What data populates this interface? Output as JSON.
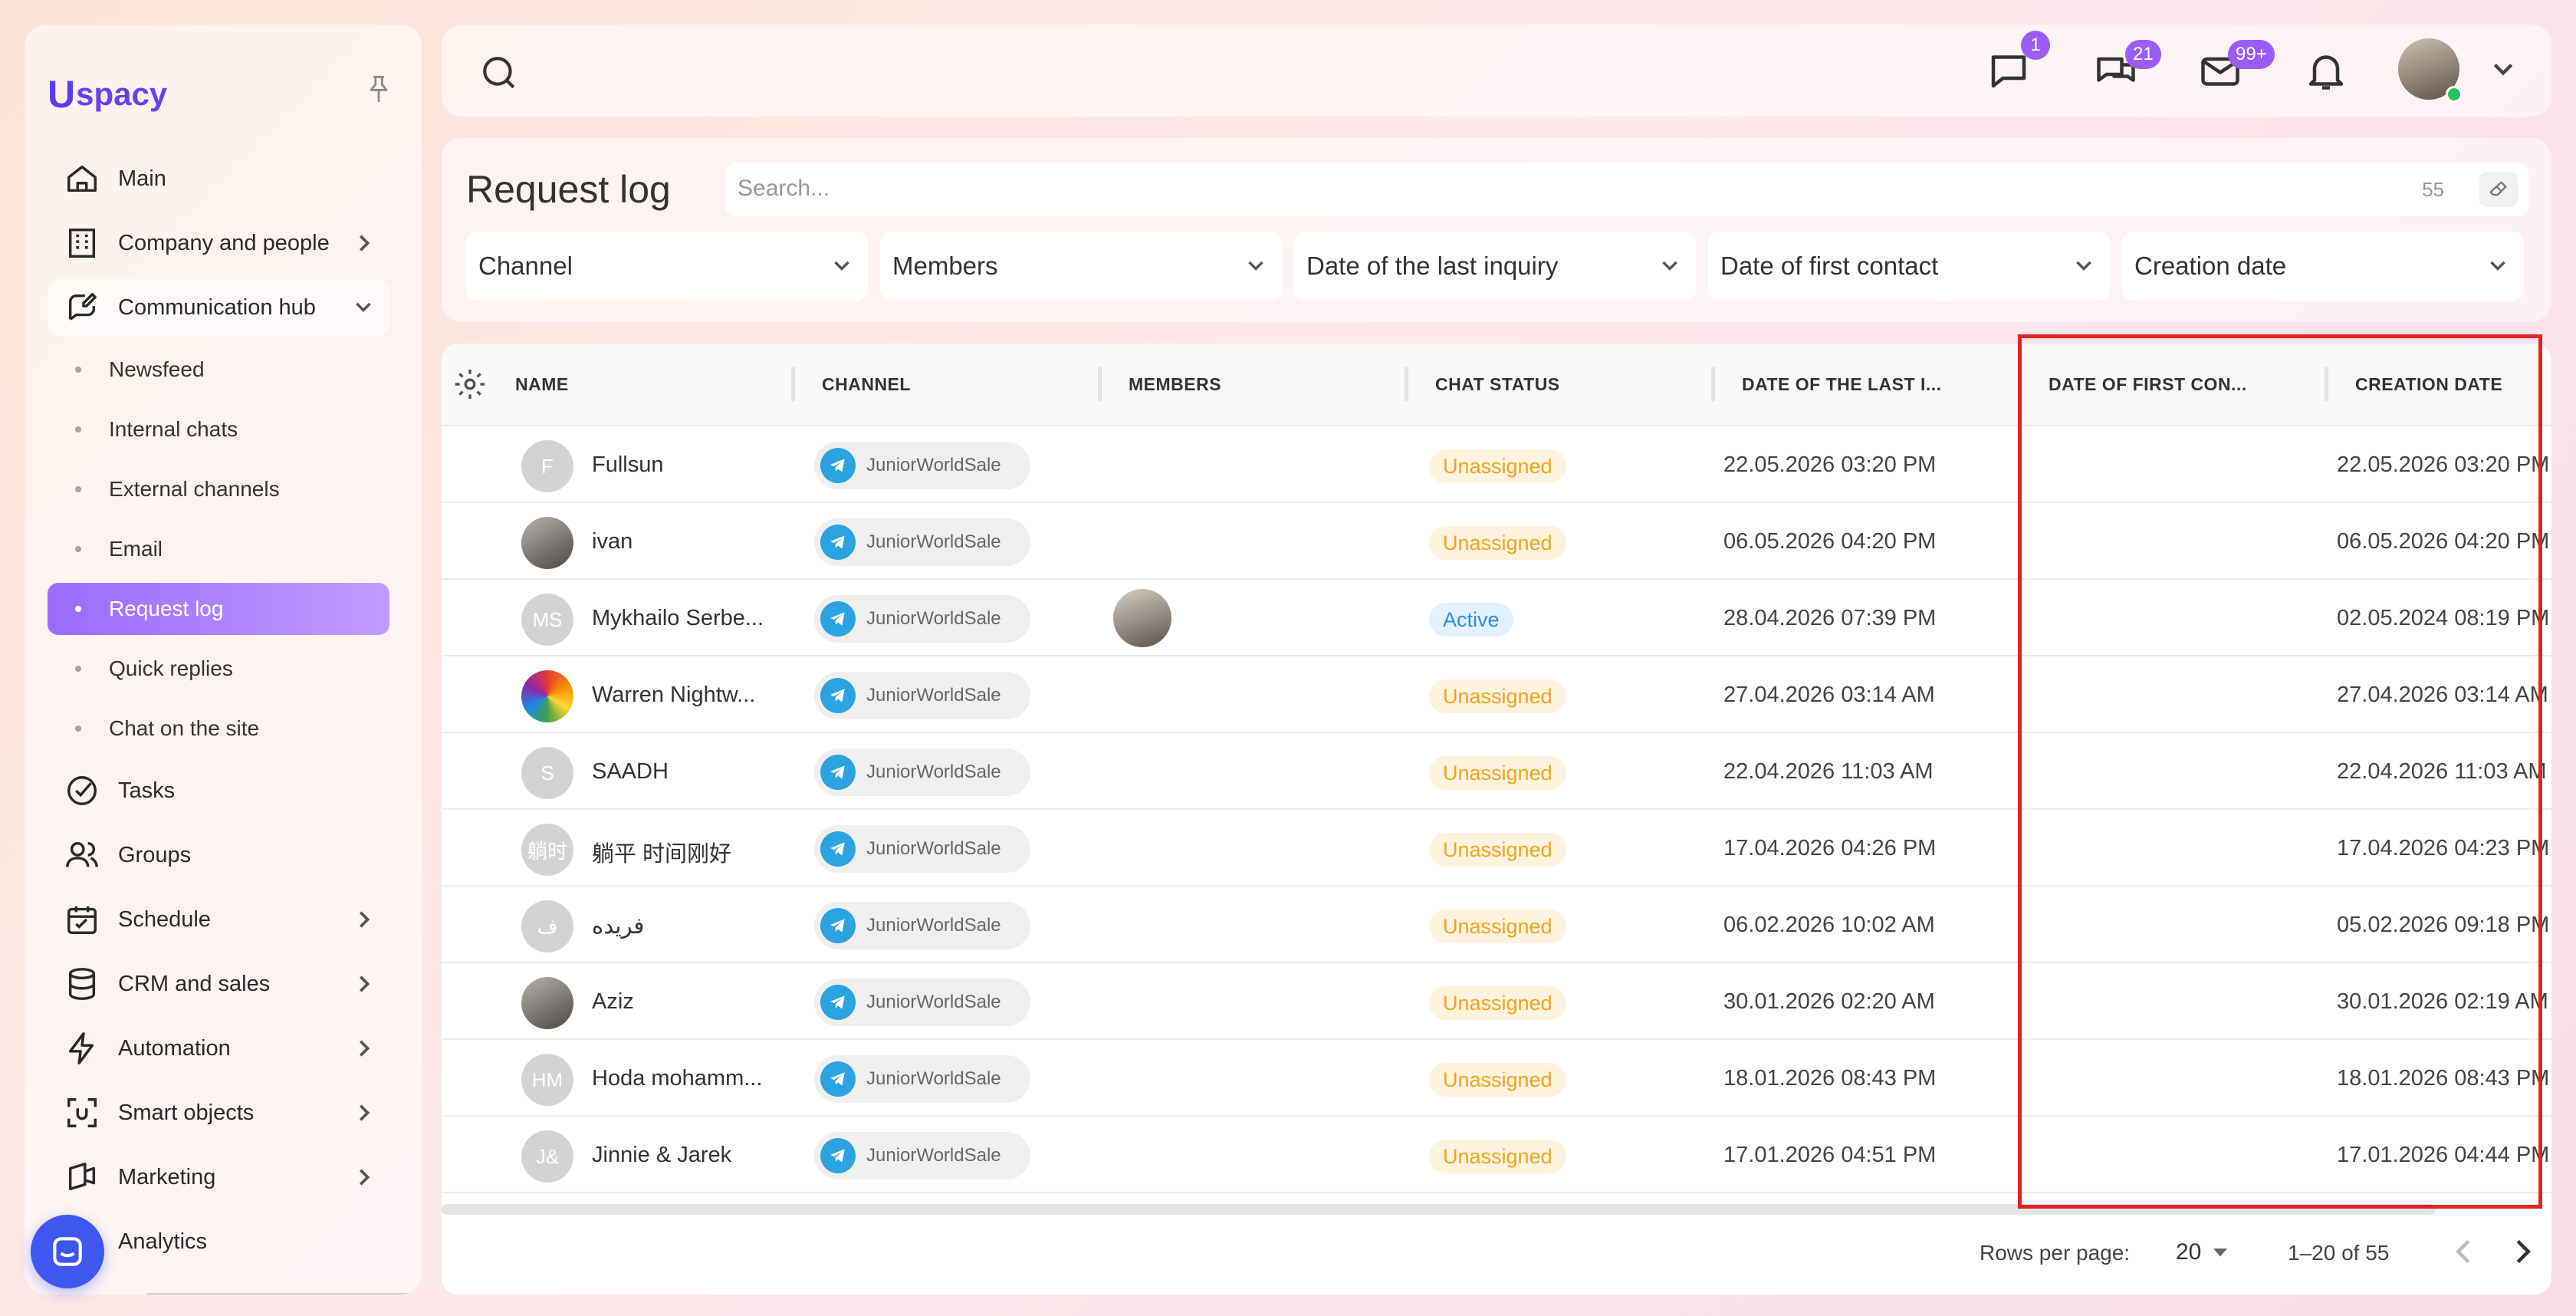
{
  "app": {
    "logo_mark": "U",
    "logo_text": "spacy"
  },
  "sidebar": {
    "items": [
      {
        "label": "Main",
        "icon": "home-icon"
      },
      {
        "label": "Company and people",
        "icon": "building-icon"
      },
      {
        "label": "Communication hub",
        "icon": "chat-edit-icon"
      }
    ],
    "sub_items": [
      "Newsfeed",
      "Internal chats",
      "External channels",
      "Email",
      "Request log",
      "Quick replies",
      "Chat on the site"
    ],
    "active_sub": "Request log",
    "items_after": [
      {
        "label": "Tasks",
        "icon": "check-circle-icon"
      },
      {
        "label": "Groups",
        "icon": "users-icon"
      },
      {
        "label": "Schedule",
        "icon": "calendar-icon"
      },
      {
        "label": "CRM and sales",
        "icon": "database-icon"
      },
      {
        "label": "Automation",
        "icon": "lightning-icon"
      },
      {
        "label": "Smart objects",
        "icon": "scan-icon"
      },
      {
        "label": "Marketing",
        "icon": "megaphone-icon"
      },
      {
        "label": "Analytics",
        "icon": "chart-icon"
      }
    ]
  },
  "topbar": {
    "badges": {
      "messages": "1",
      "chats": "21",
      "mail": "99+"
    }
  },
  "filters": {
    "title": "Request log",
    "search_placeholder": "Search...",
    "count": "55",
    "dropdowns": [
      "Channel",
      "Members",
      "Date of the last inquiry",
      "Date of first contact",
      "Creation date"
    ]
  },
  "table": {
    "columns": [
      "NAME",
      "CHANNEL",
      "MEMBERS",
      "CHAT STATUS",
      "DATE OF THE LAST I...",
      "DATE OF FIRST CON...",
      "CREATION DATE"
    ],
    "rows": [
      {
        "initials": "F",
        "avatar": "initials",
        "name": "Fullsun",
        "channel": "JuniorWorldSale",
        "member": false,
        "status": "Unassigned",
        "last": "22.05.2026 03:20 PM",
        "first": "",
        "created": "22.05.2026 03:20 PM"
      },
      {
        "initials": "",
        "avatar": "photo",
        "name": "ivan",
        "channel": "JuniorWorldSale",
        "member": false,
        "status": "Unassigned",
        "last": "06.05.2026 04:20 PM",
        "first": "",
        "created": "06.05.2026 04:20 PM"
      },
      {
        "initials": "MS",
        "avatar": "initials",
        "name": "Mykhailo Serbe...",
        "channel": "JuniorWorldSale",
        "member": true,
        "status": "Active",
        "last": "28.04.2026 07:39 PM",
        "first": "",
        "created": "02.05.2024 08:19 PM"
      },
      {
        "initials": "",
        "avatar": "rainbow",
        "name": "Warren Nightw...",
        "channel": "JuniorWorldSale",
        "member": false,
        "status": "Unassigned",
        "last": "27.04.2026 03:14 AM",
        "first": "",
        "created": "27.04.2026 03:14 AM"
      },
      {
        "initials": "S",
        "avatar": "initials",
        "name": "SAADH",
        "channel": "JuniorWorldSale",
        "member": false,
        "status": "Unassigned",
        "last": "22.04.2026 11:03 AM",
        "first": "",
        "created": "22.04.2026 11:03 AM"
      },
      {
        "initials": "躺时",
        "avatar": "initials",
        "name": "躺平 时间刚好",
        "channel": "JuniorWorldSale",
        "member": false,
        "status": "Unassigned",
        "last": "17.04.2026 04:26 PM",
        "first": "",
        "created": "17.04.2026 04:23 PM"
      },
      {
        "initials": "ف",
        "avatar": "initials",
        "name": "فريده",
        "channel": "JuniorWorldSale",
        "member": false,
        "status": "Unassigned",
        "last": "06.02.2026 10:02 AM",
        "first": "",
        "created": "05.02.2026 09:18 PM"
      },
      {
        "initials": "",
        "avatar": "photo",
        "name": "Aziz",
        "channel": "JuniorWorldSale",
        "member": false,
        "status": "Unassigned",
        "last": "30.01.2026 02:20 AM",
        "first": "",
        "created": "30.01.2026 02:19 AM"
      },
      {
        "initials": "HM",
        "avatar": "initials",
        "name": "Hoda mohamm...",
        "channel": "JuniorWorldSale",
        "member": false,
        "status": "Unassigned",
        "last": "18.01.2026 08:43 PM",
        "first": "",
        "created": "18.01.2026 08:43 PM"
      },
      {
        "initials": "J&",
        "avatar": "initials",
        "name": "Jinnie & Jarek",
        "channel": "JuniorWorldSale",
        "member": false,
        "status": "Unassigned",
        "last": "17.01.2026 04:51 PM",
        "first": "",
        "created": "17.01.2026 04:44 PM"
      }
    ]
  },
  "footer": {
    "rows_per_page_label": "Rows per page:",
    "rows_per_page": "20",
    "range": "1–20 of 55"
  },
  "colors": {
    "accent": "#9a5cf5",
    "unassigned": "#eea51f",
    "active": "#2b8ee0",
    "highlight": "#e02424"
  }
}
